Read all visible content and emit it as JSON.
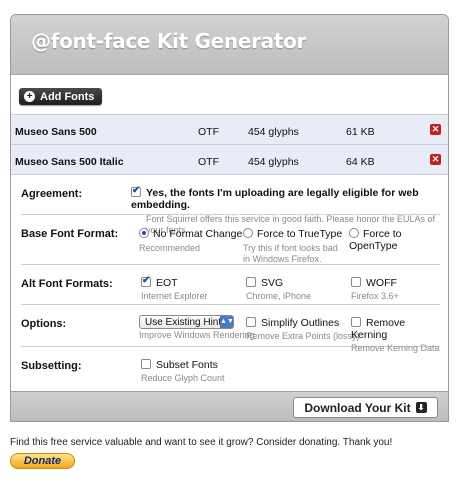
{
  "header": {
    "title": "@font-face Kit Generator"
  },
  "toolbar": {
    "add_fonts_label": "Add Fonts"
  },
  "fonts": [
    {
      "name": "Museo Sans 500",
      "format": "OTF",
      "glyphs": "454 glyphs",
      "size": "61 KB"
    },
    {
      "name": "Museo Sans 500 Italic",
      "format": "OTF",
      "glyphs": "454 glyphs",
      "size": "64 KB"
    }
  ],
  "options": {
    "agreement": {
      "label": "Agreement:",
      "text": "Yes, the fonts I'm uploading are legally eligible for web embedding.",
      "sub": "Font Squirrel offers this service in good faith. Please honor the EULAs of your fonts.",
      "checked": true
    },
    "base_format": {
      "label": "Base Font Format:",
      "choices": [
        {
          "text": "No Format Change",
          "sub": "Recommended",
          "selected": true
        },
        {
          "text": "Force to TrueType",
          "sub": "Try this if font looks bad in Windows Firefox.",
          "selected": false
        },
        {
          "text": "Force to OpenType",
          "sub": "",
          "selected": false
        }
      ]
    },
    "alt_formats": {
      "label": "Alt Font Formats:",
      "choices": [
        {
          "text": "EOT",
          "sub": "Internet Explorer",
          "checked": true
        },
        {
          "text": "SVG",
          "sub": "Chrome, iPhone",
          "checked": false
        },
        {
          "text": "WOFF",
          "sub": "Firefox 3.6+",
          "checked": false
        }
      ]
    },
    "options_row": {
      "label": "Options:",
      "hints_value": "Use Existing Hints",
      "hints_sub": "Improve Windows Rendering",
      "simplify": {
        "text": "Simplify Outlines",
        "sub": "Remove Extra Points (lossy)",
        "checked": false
      },
      "kerning": {
        "text": "Remove Kerning",
        "sub": "Remove Kerning Data",
        "checked": false
      }
    },
    "subsetting": {
      "label": "Subsetting:",
      "text": "Subset Fonts",
      "sub": "Reduce Glyph Count",
      "checked": false
    }
  },
  "download_label": "Download Your Kit",
  "footer": {
    "note": "Find this free service valuable and want to see it grow? Consider donating. Thank you!",
    "donate_label": "Donate"
  },
  "colors": {
    "accent": "#1f4ea8",
    "delete": "#c41f1f",
    "donate": "#f4a71c",
    "row_bg": "#e7ecf7"
  }
}
